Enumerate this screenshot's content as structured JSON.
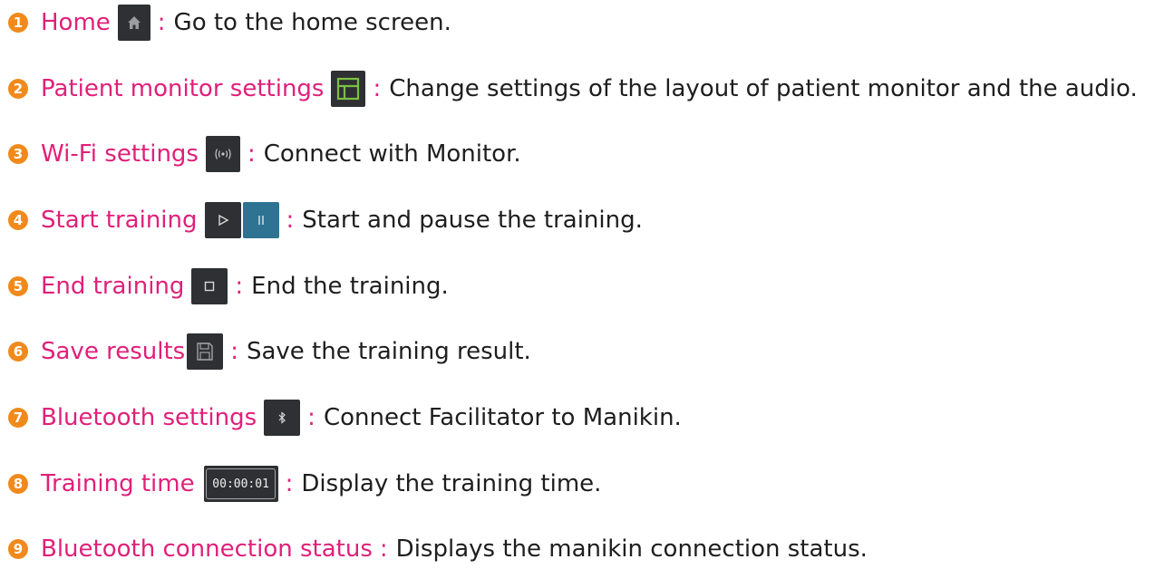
{
  "items": [
    {
      "number": "1",
      "label": "Home",
      "icon": "home-icon",
      "description": "Go to the home screen."
    },
    {
      "number": "2",
      "label": "Patient monitor settings",
      "icon": "layout-icon",
      "description": "Change settings of the layout of patient monitor and the audio."
    },
    {
      "number": "3",
      "label": "Wi-Fi settings",
      "icon": "wifi-broadcast-icon",
      "description": "Connect with Monitor."
    },
    {
      "number": "4",
      "label": "Start training",
      "icon": "play-icon, pause-icon",
      "description": "Start and pause the training."
    },
    {
      "number": "5",
      "label": "End training",
      "icon": "stop-icon",
      "description": "End the training."
    },
    {
      "number": "6",
      "label": "Save results",
      "icon": "save-icon",
      "description": "Save the training result."
    },
    {
      "number": "7",
      "label": "Bluetooth settings",
      "icon": "bluetooth-icon",
      "description": "Connect Facilitator to Manikin."
    },
    {
      "number": "8",
      "label": "Training time",
      "icon": "timer-display",
      "timer_value": "00:00:01",
      "description": "Display the training time."
    },
    {
      "number": "9",
      "label": "Bluetooth connection status",
      "description": "Displays the manikin connection status."
    }
  ],
  "colon": ":",
  "colors": {
    "number_badge": "#f08a1c",
    "label": "#e0207a",
    "description": "#1e1e1e",
    "icon_bg": "#2f3033",
    "pause_bg": "#2e7392",
    "layout_icon_accent": "#7bc043"
  }
}
